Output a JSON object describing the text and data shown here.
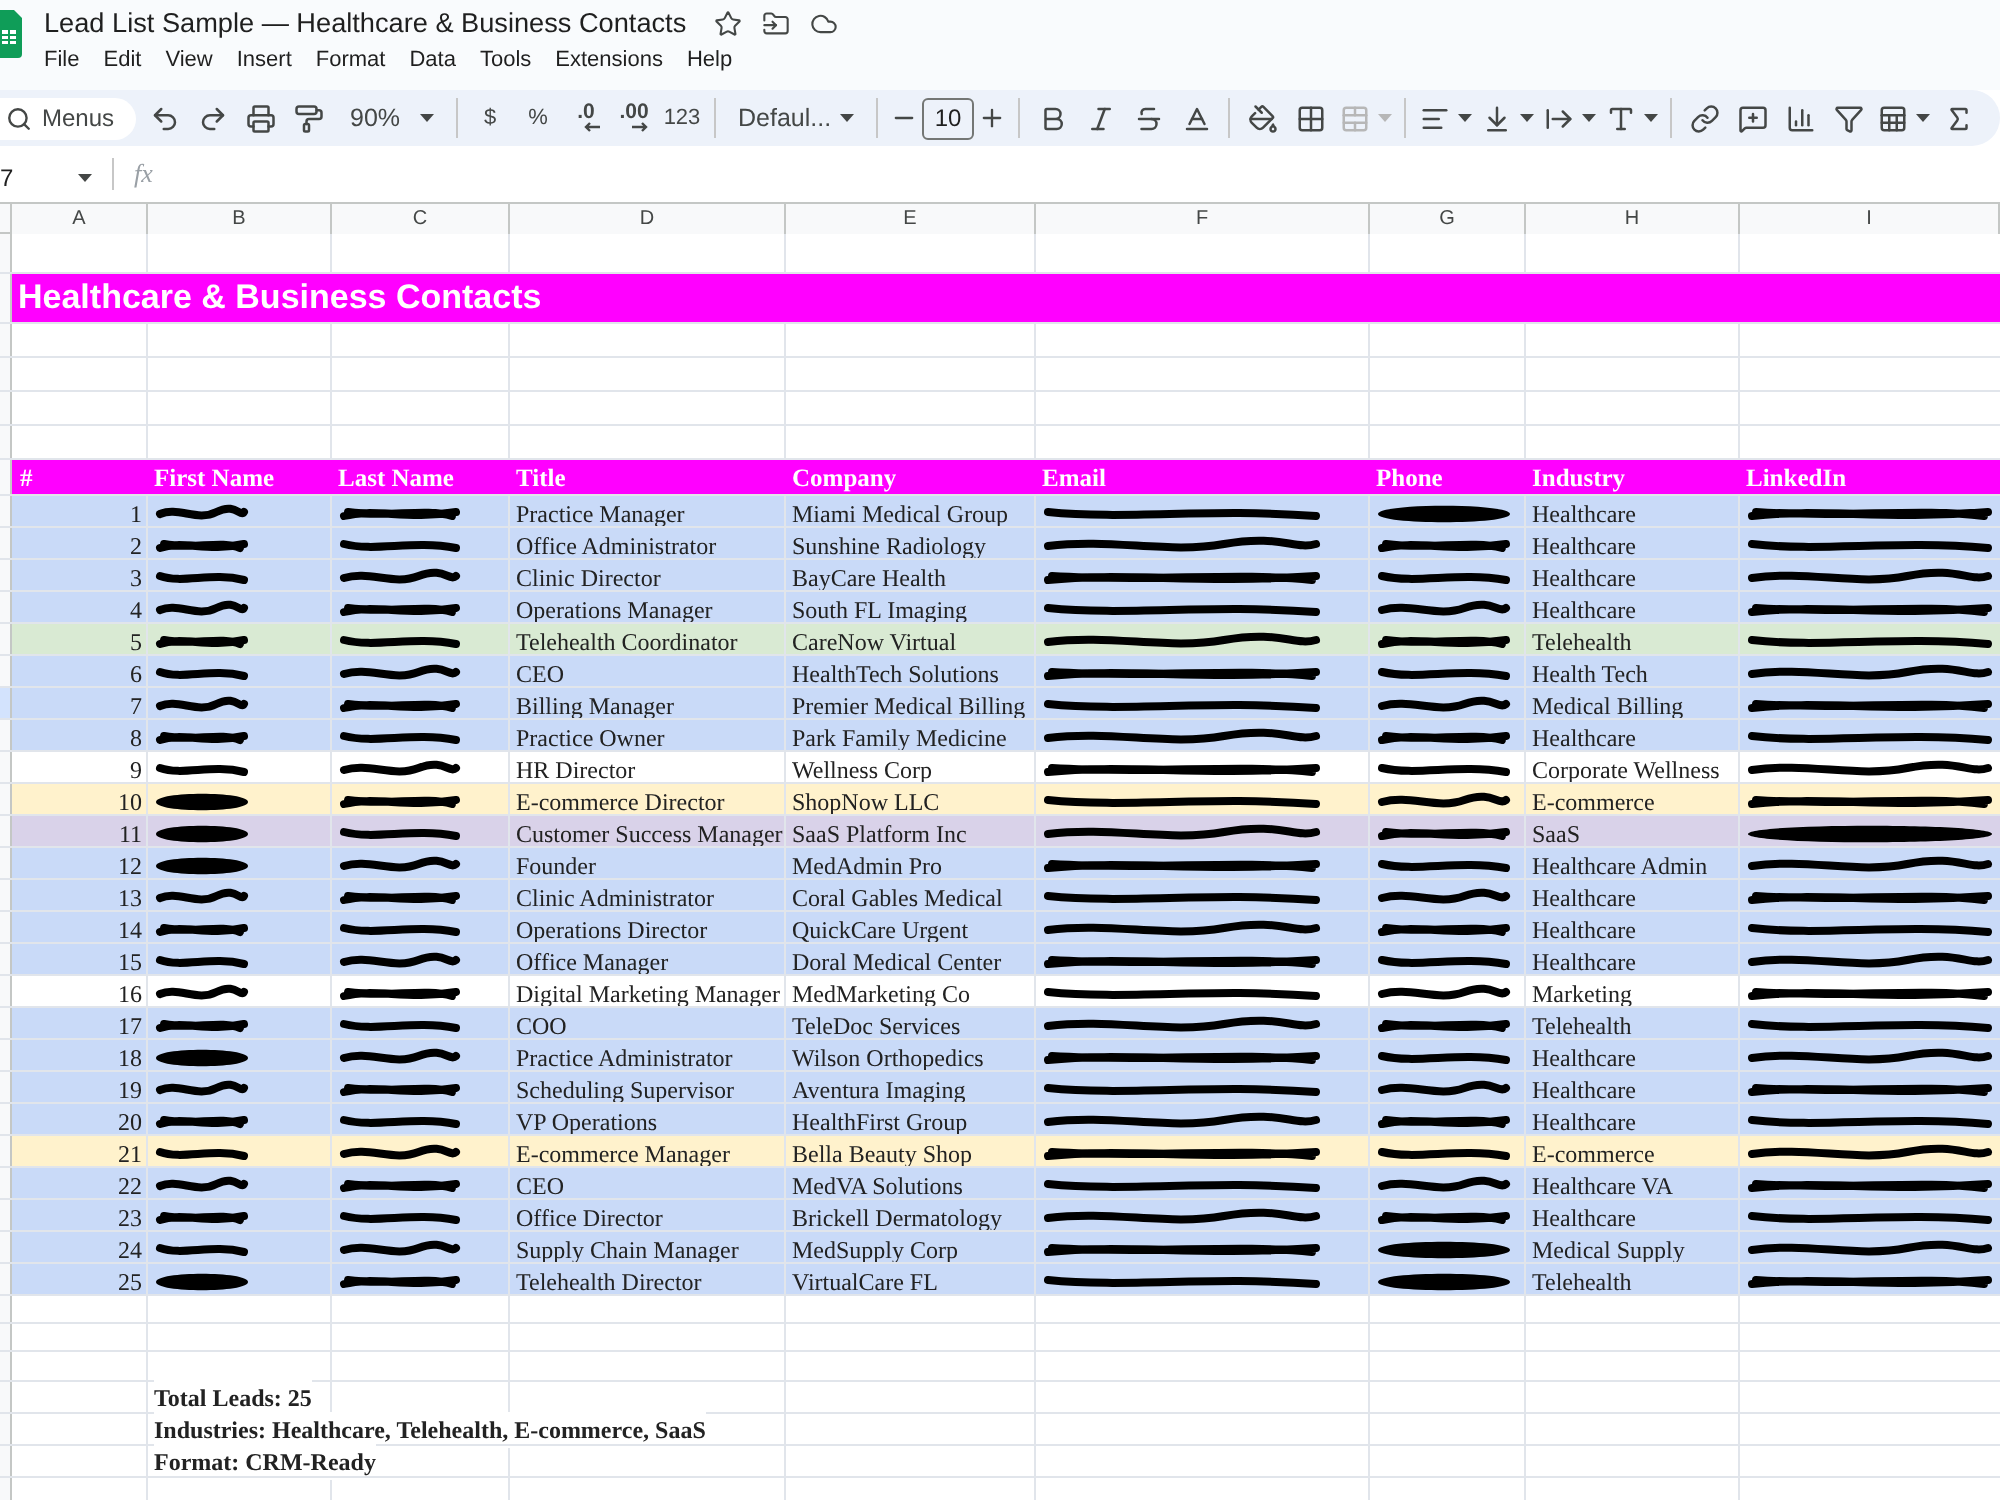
{
  "document": {
    "title": "Lead List Sample — Healthcare & Business Contacts"
  },
  "menu": [
    "File",
    "Edit",
    "View",
    "Insert",
    "Format",
    "Data",
    "Tools",
    "Extensions",
    "Help"
  ],
  "toolbar": {
    "search": {
      "label": "Menus"
    },
    "groups": [
      [
        {
          "kind": "undo",
          "disabled": false
        },
        {
          "kind": "redo",
          "disabled": false
        },
        {
          "kind": "print",
          "disabled": false
        },
        {
          "kind": "paint-format",
          "disabled": false
        },
        {
          "kind": "zoom",
          "label": "90%",
          "disabled": false
        }
      ],
      [
        {
          "kind": "text",
          "label": "$",
          "disabled": false
        },
        {
          "kind": "text",
          "label": "%",
          "disabled": false
        },
        {
          "kind": "decimal-decrease",
          "label": ".0",
          "disabled": false
        },
        {
          "kind": "decimal-increase",
          "label": ".00",
          "disabled": false
        },
        {
          "kind": "text",
          "label": "123",
          "disabled": false
        }
      ],
      [
        {
          "kind": "font",
          "label": "Defaul...",
          "disabled": false
        }
      ],
      [
        {
          "kind": "minus",
          "disabled": false
        },
        {
          "kind": "font-size",
          "value": "10"
        },
        {
          "kind": "plus",
          "disabled": false
        }
      ],
      [
        {
          "kind": "bold",
          "disabled": false
        },
        {
          "kind": "italic",
          "disabled": false
        },
        {
          "kind": "strikethrough",
          "disabled": false
        },
        {
          "kind": "text-color",
          "disabled": false
        }
      ],
      [
        {
          "kind": "fill-color",
          "disabled": false
        },
        {
          "kind": "borders",
          "disabled": false
        },
        {
          "kind": "merge",
          "disabled": true
        }
      ],
      [
        {
          "kind": "align",
          "disabled": false
        },
        {
          "kind": "valign",
          "disabled": false
        },
        {
          "kind": "wrap",
          "disabled": false
        },
        {
          "kind": "rotate",
          "disabled": false
        }
      ],
      [
        {
          "kind": "link",
          "disabled": false
        },
        {
          "kind": "comment",
          "disabled": false
        },
        {
          "kind": "chart",
          "disabled": false
        },
        {
          "kind": "filter",
          "disabled": false
        },
        {
          "kind": "filter-views",
          "disabled": false
        },
        {
          "kind": "functions",
          "disabled": false
        }
      ]
    ]
  },
  "formula_bar": {
    "name_box": "7",
    "function_label": "fx"
  },
  "sheet": {
    "column_letters": [
      "A",
      "B",
      "C",
      "D",
      "E",
      "F",
      "G",
      "H",
      "I"
    ],
    "banner": "Healthcare & Business Contacts",
    "table": {
      "columns": [
        "#",
        "First Name",
        "Last Name",
        "Title",
        "Company",
        "Email",
        "Phone",
        "Industry",
        "LinkedIn"
      ],
      "rows": [
        {
          "number": "1",
          "color": "#c9daf8",
          "selected": false,
          "first_name": {
            "kind": "scribble"
          },
          "last_name": {
            "kind": "scribble"
          },
          "title": "Practice Manager",
          "company": "Miami Medical Group",
          "email": {
            "kind": "scribble"
          },
          "phone": {
            "kind": "blot"
          },
          "industry": "Healthcare",
          "linkedin": {
            "kind": "scribble"
          }
        },
        {
          "number": "2",
          "color": "#c9daf8",
          "selected": false,
          "first_name": {
            "kind": "scribble"
          },
          "last_name": {
            "kind": "scribble"
          },
          "title": "Office Administrator",
          "company": "Sunshine Radiology",
          "email": {
            "kind": "scribble"
          },
          "phone": {
            "kind": "scribble"
          },
          "industry": "Healthcare",
          "linkedin": {
            "kind": "scribble"
          }
        },
        {
          "number": "3",
          "color": "#c9daf8",
          "selected": false,
          "first_name": {
            "kind": "scribble"
          },
          "last_name": {
            "kind": "scribble"
          },
          "title": "Clinic Director",
          "company": "BayCare Health",
          "email": {
            "kind": "scribble"
          },
          "phone": {
            "kind": "scribble"
          },
          "industry": "Healthcare",
          "linkedin": {
            "kind": "scribble"
          }
        },
        {
          "number": "4",
          "color": "#c9daf8",
          "selected": false,
          "first_name": {
            "kind": "scribble"
          },
          "last_name": {
            "kind": "scribble"
          },
          "title": "Operations Manager",
          "company": "South FL Imaging",
          "email": {
            "kind": "scribble"
          },
          "phone": {
            "kind": "scribble"
          },
          "industry": "Healthcare",
          "linkedin": {
            "kind": "scribble"
          }
        },
        {
          "number": "5",
          "color": "#d9ead3",
          "selected": false,
          "first_name": {
            "kind": "scribble"
          },
          "last_name": {
            "kind": "scribble"
          },
          "title": "Telehealth Coordinator",
          "company": "CareNow Virtual",
          "email": {
            "kind": "scribble"
          },
          "phone": {
            "kind": "scribble"
          },
          "industry": "Telehealth",
          "linkedin": {
            "kind": "scribble"
          }
        },
        {
          "number": "6",
          "color": "#c9daf8",
          "selected": false,
          "first_name": {
            "kind": "scribble"
          },
          "last_name": {
            "kind": "scribble"
          },
          "title": "CEO",
          "company": "HealthTech Solutions",
          "email": {
            "kind": "scribble"
          },
          "phone": {
            "kind": "scribble"
          },
          "industry": "Health Tech",
          "linkedin": {
            "kind": "scribble"
          }
        },
        {
          "number": "7",
          "color": "#c9daf8",
          "selected": true,
          "first_name": {
            "kind": "scribble"
          },
          "last_name": {
            "kind": "scribble"
          },
          "title": "Billing Manager",
          "company": "Premier Medical Billing",
          "email": {
            "kind": "scribble"
          },
          "phone": {
            "kind": "scribble"
          },
          "industry": "Medical Billing",
          "linkedin": {
            "kind": "scribble"
          }
        },
        {
          "number": "8",
          "color": "#c9daf8",
          "selected": false,
          "first_name": {
            "kind": "scribble"
          },
          "last_name": {
            "kind": "scribble"
          },
          "title": "Practice Owner",
          "company": "Park Family Medicine",
          "email": {
            "kind": "scribble"
          },
          "phone": {
            "kind": "scribble"
          },
          "industry": "Healthcare",
          "linkedin": {
            "kind": "scribble"
          }
        },
        {
          "number": "9",
          "color": "#ffffff",
          "selected": false,
          "first_name": {
            "kind": "scribble"
          },
          "last_name": {
            "kind": "scribble"
          },
          "title": "HR Director",
          "company": "Wellness Corp",
          "email": {
            "kind": "scribble"
          },
          "phone": {
            "kind": "scribble"
          },
          "industry": "Corporate Wellness",
          "linkedin": {
            "kind": "scribble"
          }
        },
        {
          "number": "10",
          "color": "#fff2cc",
          "selected": false,
          "first_name": {
            "kind": "blot"
          },
          "last_name": {
            "kind": "scribble"
          },
          "title": "E-commerce Director",
          "company": "ShopNow LLC",
          "email": {
            "kind": "scribble"
          },
          "phone": {
            "kind": "scribble"
          },
          "industry": "E-commerce",
          "linkedin": {
            "kind": "scribble"
          }
        },
        {
          "number": "11",
          "color": "#d9d2e9",
          "selected": false,
          "first_name": {
            "kind": "blot"
          },
          "last_name": {
            "kind": "scribble"
          },
          "title": "Customer Success Manager",
          "company": "SaaS Platform Inc",
          "email": {
            "kind": "scribble"
          },
          "phone": {
            "kind": "scribble"
          },
          "industry": "SaaS",
          "linkedin": {
            "kind": "blot"
          }
        },
        {
          "number": "12",
          "color": "#c9daf8",
          "selected": false,
          "first_name": {
            "kind": "blot"
          },
          "last_name": {
            "kind": "scribble"
          },
          "title": "Founder",
          "company": "MedAdmin Pro",
          "email": {
            "kind": "scribble"
          },
          "phone": {
            "kind": "scribble"
          },
          "industry": "Healthcare Admin",
          "linkedin": {
            "kind": "scribble"
          }
        },
        {
          "number": "13",
          "color": "#c9daf8",
          "selected": false,
          "first_name": {
            "kind": "scribble"
          },
          "last_name": {
            "kind": "scribble"
          },
          "title": "Clinic Administrator",
          "company": "Coral Gables Medical",
          "email": {
            "kind": "scribble"
          },
          "phone": {
            "kind": "scribble"
          },
          "industry": "Healthcare",
          "linkedin": {
            "kind": "scribble"
          }
        },
        {
          "number": "14",
          "color": "#c9daf8",
          "selected": false,
          "first_name": {
            "kind": "scribble"
          },
          "last_name": {
            "kind": "scribble"
          },
          "title": "Operations Director",
          "company": "QuickCare Urgent",
          "email": {
            "kind": "scribble"
          },
          "phone": {
            "kind": "scribble"
          },
          "industry": "Healthcare",
          "linkedin": {
            "kind": "scribble"
          }
        },
        {
          "number": "15",
          "color": "#c9daf8",
          "selected": false,
          "first_name": {
            "kind": "scribble"
          },
          "last_name": {
            "kind": "scribble"
          },
          "title": "Office Manager",
          "company": "Doral Medical Center",
          "email": {
            "kind": "scribble"
          },
          "phone": {
            "kind": "scribble"
          },
          "industry": "Healthcare",
          "linkedin": {
            "kind": "scribble"
          }
        },
        {
          "number": "16",
          "color": "#ffffff",
          "selected": false,
          "first_name": {
            "kind": "scribble"
          },
          "last_name": {
            "kind": "scribble"
          },
          "title": "Digital Marketing Manager",
          "company": "MedMarketing Co",
          "email": {
            "kind": "scribble"
          },
          "phone": {
            "kind": "scribble"
          },
          "industry": "Marketing",
          "linkedin": {
            "kind": "scribble"
          }
        },
        {
          "number": "17",
          "color": "#c9daf8",
          "selected": false,
          "first_name": {
            "kind": "scribble"
          },
          "last_name": {
            "kind": "scribble"
          },
          "title": "COO",
          "company": "TeleDoc Services",
          "email": {
            "kind": "scribble"
          },
          "phone": {
            "kind": "scribble"
          },
          "industry": "Telehealth",
          "linkedin": {
            "kind": "scribble"
          }
        },
        {
          "number": "18",
          "color": "#c9daf8",
          "selected": false,
          "first_name": {
            "kind": "blot"
          },
          "last_name": {
            "kind": "scribble"
          },
          "title": "Practice Administrator",
          "company": "Wilson Orthopedics",
          "email": {
            "kind": "scribble"
          },
          "phone": {
            "kind": "scribble"
          },
          "industry": "Healthcare",
          "linkedin": {
            "kind": "scribble"
          }
        },
        {
          "number": "19",
          "color": "#c9daf8",
          "selected": false,
          "first_name": {
            "kind": "scribble"
          },
          "last_name": {
            "kind": "scribble"
          },
          "title": "Scheduling Supervisor",
          "company": "Aventura Imaging",
          "email": {
            "kind": "scribble"
          },
          "phone": {
            "kind": "scribble"
          },
          "industry": "Healthcare",
          "linkedin": {
            "kind": "scribble"
          }
        },
        {
          "number": "20",
          "color": "#c9daf8",
          "selected": false,
          "first_name": {
            "kind": "scribble"
          },
          "last_name": {
            "kind": "scribble"
          },
          "title": "VP Operations",
          "company": "HealthFirst Group",
          "email": {
            "kind": "scribble"
          },
          "phone": {
            "kind": "scribble"
          },
          "industry": "Healthcare",
          "linkedin": {
            "kind": "scribble"
          }
        },
        {
          "number": "21",
          "color": "#fff2cc",
          "selected": false,
          "first_name": {
            "kind": "scribble"
          },
          "last_name": {
            "kind": "scribble"
          },
          "title": "E-commerce Manager",
          "company": "Bella Beauty Shop",
          "email": {
            "kind": "scribble"
          },
          "phone": {
            "kind": "scribble"
          },
          "industry": "E-commerce",
          "linkedin": {
            "kind": "scribble"
          }
        },
        {
          "number": "22",
          "color": "#c9daf8",
          "selected": false,
          "first_name": {
            "kind": "scribble"
          },
          "last_name": {
            "kind": "scribble"
          },
          "title": "CEO",
          "company": "MedVA Solutions",
          "email": {
            "kind": "scribble"
          },
          "phone": {
            "kind": "scribble"
          },
          "industry": "Healthcare VA",
          "linkedin": {
            "kind": "scribble"
          }
        },
        {
          "number": "23",
          "color": "#c9daf8",
          "selected": false,
          "first_name": {
            "kind": "scribble"
          },
          "last_name": {
            "kind": "scribble"
          },
          "title": "Office Director",
          "company": "Brickell Dermatology",
          "email": {
            "kind": "scribble"
          },
          "phone": {
            "kind": "scribble"
          },
          "industry": "Healthcare",
          "linkedin": {
            "kind": "scribble"
          }
        },
        {
          "number": "24",
          "color": "#c9daf8",
          "selected": false,
          "first_name": {
            "kind": "scribble"
          },
          "last_name": {
            "kind": "scribble"
          },
          "title": "Supply Chain Manager",
          "company": "MedSupply Corp",
          "email": {
            "kind": "scribble"
          },
          "phone": {
            "kind": "blot"
          },
          "industry": "Medical Supply",
          "linkedin": {
            "kind": "scribble"
          }
        },
        {
          "number": "25",
          "color": "#c9daf8",
          "selected": false,
          "first_name": {
            "kind": "blot"
          },
          "last_name": {
            "kind": "scribble"
          },
          "title": "Telehealth Director",
          "company": "VirtualCare FL",
          "email": {
            "kind": "scribble"
          },
          "phone": {
            "kind": "blot"
          },
          "industry": "Telehealth",
          "linkedin": {
            "kind": "scribble"
          }
        }
      ]
    },
    "summary": [
      "Total Leads: 25",
      "Industries: Healthcare, Telehealth, E-commerce, SaaS",
      "Format: CRM-Ready"
    ]
  }
}
